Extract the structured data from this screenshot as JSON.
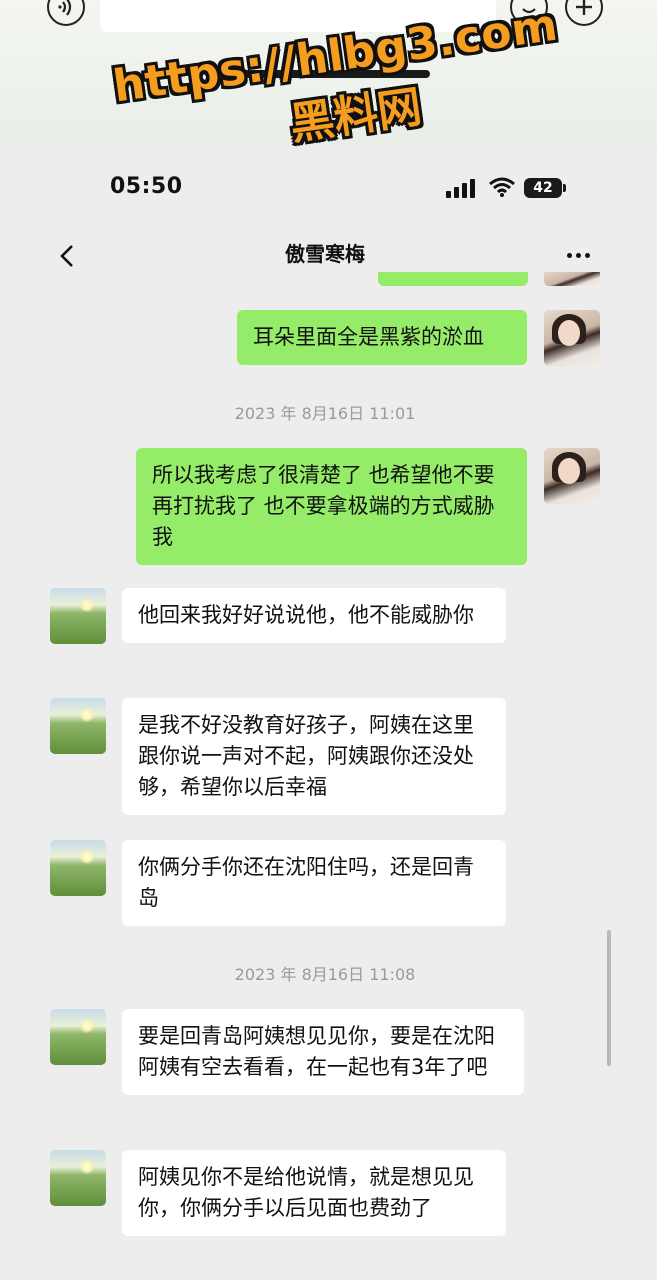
{
  "status_bar": {
    "time": "05:50",
    "battery": "42"
  },
  "header": {
    "title": "傲雪寒梅"
  },
  "watermark": {
    "url": "https://hlbg3.com",
    "name": "黑料网"
  },
  "messages": [
    {
      "side": "right",
      "text": "耳朵里面全是黑紫的淤血"
    },
    {
      "type": "timestamp",
      "text": "2023 年 8月16日 11:01"
    },
    {
      "side": "right",
      "text": "所以我考虑了很清楚了 也希望他不要再打扰我了 也不要拿极端的方式威胁我"
    },
    {
      "side": "left",
      "text": "他回来我好好说说他，他不能威胁你"
    },
    {
      "side": "left",
      "text": "是我不好没教育好孩子，阿姨在这里跟你说一声对不起，阿姨跟你还没处够，希望你以后幸福"
    },
    {
      "side": "left",
      "text": "你俩分手你还在沈阳住吗，还是回青岛"
    },
    {
      "type": "timestamp",
      "text": "2023 年 8月16日 11:08"
    },
    {
      "side": "left",
      "text": "要是回青岛阿姨想见见你，要是在沈阳阿姨有空去看看，在一起也有3年了吧"
    },
    {
      "side": "left",
      "text": "阿姨见你不是给他说情，就是想见见你，你俩分手以后见面也费劲了"
    }
  ],
  "icons": {
    "voice": "voice-input-icon",
    "emoji": "emoji-icon",
    "plus": "plus-icon",
    "back": "back-chevron-icon",
    "more": "more-dots-icon",
    "signal": "cellular-signal-icon",
    "wifi": "wifi-icon"
  },
  "colors": {
    "my_bubble": "#95ec69",
    "their_bubble": "#ffffff",
    "background": "#ededed",
    "watermark": "#f59d1f"
  }
}
